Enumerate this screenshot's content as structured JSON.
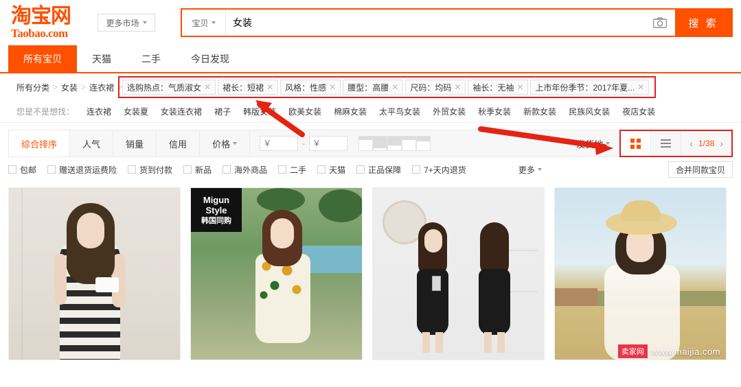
{
  "header": {
    "logo_cn": "淘宝网",
    "logo_en": "Taobao.com",
    "market_button": "更多市场",
    "market_icon": "chevron-down-icon"
  },
  "search": {
    "category": "宝贝",
    "category_icon": "chevron-down-icon",
    "query": "女装",
    "placeholder": "",
    "camera_icon": "camera-icon",
    "button_label": "搜 索"
  },
  "nav_tabs": [
    {
      "label": "所有宝贝",
      "active": true
    },
    {
      "label": "天猫",
      "active": false
    },
    {
      "label": "二手",
      "active": false
    },
    {
      "label": "今日发现",
      "active": false
    }
  ],
  "breadcrumb": {
    "items": [
      "所有分类",
      "女装",
      "连衣裙"
    ],
    "separator": ">"
  },
  "filter_tags": [
    {
      "label": "选购热点：气质淑女",
      "remove_icon": "close-icon"
    },
    {
      "label": "裙长：短裙",
      "remove_icon": "close-icon"
    },
    {
      "label": "风格：性感",
      "remove_icon": "close-icon"
    },
    {
      "label": "腰型：高腰",
      "remove_icon": "close-icon"
    },
    {
      "label": "尺码：均码",
      "remove_icon": "close-icon"
    },
    {
      "label": "袖长：无袖",
      "remove_icon": "close-icon"
    },
    {
      "label": "上市年份季节：2017年夏...",
      "remove_icon": "close-icon"
    }
  ],
  "suggestions": {
    "label": "您是不是想找：",
    "items": [
      "连衣裙",
      "女装夏",
      "女装连衣裙",
      "裙子",
      "韩版女装",
      "欧美女装",
      "棉麻女装",
      "太平鸟女装",
      "外贸女装",
      "秋季女装",
      "新款女装",
      "民族风女装",
      "夜店女装"
    ]
  },
  "sortbar": {
    "items": [
      {
        "label": "综合排序",
        "active": true,
        "icon": null
      },
      {
        "label": "人气",
        "active": false,
        "icon": null
      },
      {
        "label": "销量",
        "active": false,
        "icon": null
      },
      {
        "label": "信用",
        "active": false,
        "icon": null
      },
      {
        "label": "价格",
        "active": false,
        "icon": "chevron-down-icon"
      }
    ],
    "price_min_placeholder": "￥",
    "price_min_value": "",
    "price_max_placeholder": "￥",
    "price_max_value": "",
    "price_separator": "-",
    "histogram_icon": "price-histogram",
    "ship_from": "发货地",
    "ship_from_icon": "chevron-down-icon",
    "grid_view_icon": "grid-view-icon",
    "list_view_icon": "list-view-icon",
    "grid_view_active": true,
    "prev_icon": "chevron-left-icon",
    "next_icon": "chevron-right-icon",
    "page_indicator": "1/38"
  },
  "checkbox_filters": [
    {
      "label": "包邮",
      "checked": false
    },
    {
      "label": "赠送退货运费险",
      "checked": false
    },
    {
      "label": "货到付款",
      "checked": false
    },
    {
      "label": "新品",
      "checked": false
    },
    {
      "label": "海外商品",
      "checked": false
    },
    {
      "label": "二手",
      "checked": false
    },
    {
      "label": "天猫",
      "checked": false
    },
    {
      "label": "正品保障",
      "checked": false
    },
    {
      "label": "7+天内退货",
      "checked": false
    }
  ],
  "more_filters": {
    "label": "更多",
    "icon": "chevron-down-icon"
  },
  "merge_button": {
    "label": "合并同款宝贝"
  },
  "products": [
    {
      "name": "product-card-1",
      "badge": null
    },
    {
      "name": "product-card-2",
      "badge": {
        "line1": "Migun",
        "line2": "Style",
        "line3": "韩国同购"
      }
    },
    {
      "name": "product-card-3",
      "badge": null
    },
    {
      "name": "product-card-4",
      "badge": null
    }
  ],
  "watermark": {
    "badge": "卖家网",
    "text": "www.maijia.com"
  },
  "colors": {
    "brand_orange": "#ff5000",
    "annotation_red": "#e02020",
    "text_primary": "#3c3c3c",
    "text_muted": "#999999"
  }
}
